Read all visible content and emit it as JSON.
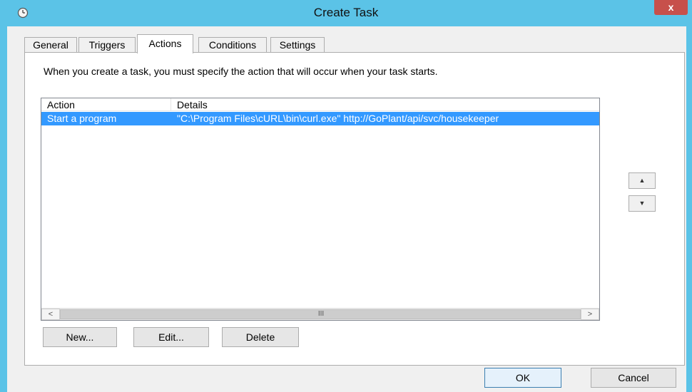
{
  "window": {
    "title": "Create Task",
    "close_glyph": "x",
    "title_icon": "clock-icon"
  },
  "tabs": [
    {
      "label": "General",
      "active": false
    },
    {
      "label": "Triggers",
      "active": false
    },
    {
      "label": "Actions",
      "active": true
    },
    {
      "label": "Conditions",
      "active": false
    },
    {
      "label": "Settings",
      "active": false
    }
  ],
  "actions_panel": {
    "description": "When you create a task, you must specify the action that will occur when your task starts.",
    "columns": [
      "Action",
      "Details"
    ],
    "rows": [
      {
        "action": "Start a program",
        "details": "\"C:\\Program Files\\cURL\\bin\\curl.exe\" http://GoPlant/api/svc/housekeeper",
        "selected": true
      }
    ],
    "scroll_left_glyph": "<",
    "scroll_right_glyph": ">",
    "scroll_grip": "III",
    "move_up_glyph": "▲",
    "move_down_glyph": "▼",
    "new_label": "New...",
    "edit_label": "Edit...",
    "delete_label": "Delete"
  },
  "footer": {
    "ok_label": "OK",
    "cancel_label": "Cancel"
  },
  "colors": {
    "title_bar": "#5bc3e7",
    "close_button": "#c7504b",
    "selection": "#3399ff",
    "dialog_bg": "#f0f0f0"
  }
}
